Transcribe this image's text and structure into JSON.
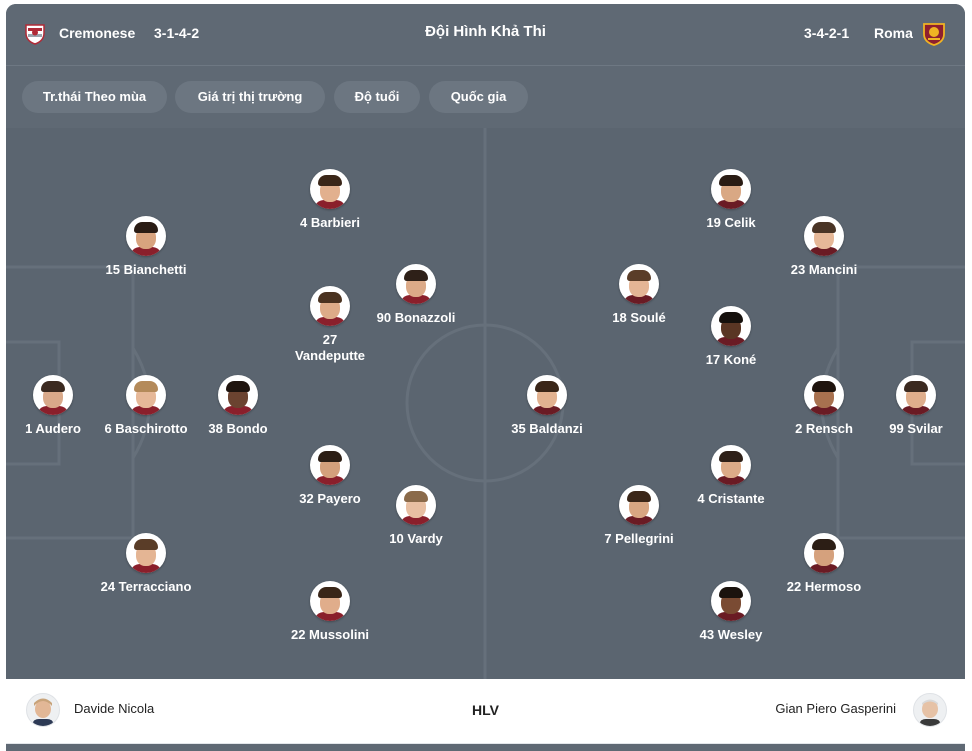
{
  "header": {
    "home_team": "Cremonese",
    "home_formation": "3-1-4-2",
    "title": "Đội Hình Khả Thi",
    "away_formation": "3-4-2-1",
    "away_team": "Roma",
    "home_logo_icon": "cremonese-crest-icon",
    "away_logo_icon": "roma-crest-icon"
  },
  "filters": [
    "Tr.thái Theo mùa",
    "Giá trị thị trường",
    "Độ tuổi",
    "Quốc gia"
  ],
  "home_players": [
    {
      "label": "1 Audero",
      "skin": "#d9a98a",
      "hair": "#3b2a20",
      "shirt": "#8a1f2b"
    },
    {
      "label": "6 Baschirotto",
      "skin": "#e6b898",
      "hair": "#b48a5a",
      "shirt": "#8a1f2b"
    },
    {
      "label": "38 Bondo",
      "skin": "#6b4330",
      "hair": "#1f140e",
      "shirt": "#8a1f2b"
    },
    {
      "label": "15 Bianchetti",
      "skin": "#d8a37e",
      "hair": "#2a1c14",
      "shirt": "#8a1f2b"
    },
    {
      "label": "24 Terracciano",
      "skin": "#e4b594",
      "hair": "#5a3d28",
      "shirt": "#8a1f2b"
    },
    {
      "label": "4 Barbieri",
      "skin": "#e2b08e",
      "hair": "#3a2618",
      "shirt": "#8a1f2b"
    },
    {
      "label": "27 Vandeputte",
      "skin": "#ddab88",
      "hair": "#4a3220",
      "shirt": "#8a1f2b"
    },
    {
      "label": "32 Payero",
      "skin": "#d4a07c",
      "hair": "#2c1e15",
      "shirt": "#8a1f2b"
    },
    {
      "label": "22 Mussolini",
      "skin": "#e0ad8b",
      "hair": "#3a2618",
      "shirt": "#8a1f2b"
    },
    {
      "label": "90 Bonazzoli",
      "skin": "#dcaa88",
      "hair": "#2e2018",
      "shirt": "#8a1f2b"
    },
    {
      "label": "10 Vardy",
      "skin": "#e8bfa2",
      "hair": "#8a6a4a",
      "shirt": "#8a1f2b"
    }
  ],
  "away_players": [
    {
      "label": "99 Svilar",
      "skin": "#dfae8c",
      "hair": "#3b2a20",
      "shirt": "#6a1b24"
    },
    {
      "label": "23 Mancini",
      "skin": "#e6b898",
      "hair": "#4a3526",
      "shirt": "#6a1b24"
    },
    {
      "label": "2 Rensch",
      "skin": "#a8714f",
      "hair": "#1f140e",
      "shirt": "#6a1b24"
    },
    {
      "label": "22 Hermoso",
      "skin": "#d5a17d",
      "hair": "#2c1e15",
      "shirt": "#6a1b24"
    },
    {
      "label": "19 Celik",
      "skin": "#d9a884",
      "hair": "#2a1c14",
      "shirt": "#6a1b24"
    },
    {
      "label": "17 Koné",
      "skin": "#5a3624",
      "hair": "#15100c",
      "shirt": "#6a1b24"
    },
    {
      "label": "4 Cristante",
      "skin": "#dcab88",
      "hair": "#2e2018",
      "shirt": "#6a1b24"
    },
    {
      "label": "43 Wesley",
      "skin": "#7a4b33",
      "hair": "#1b130e",
      "shirt": "#6a1b24"
    },
    {
      "label": "18 Soulé",
      "skin": "#e4b595",
      "hair": "#5a3d28",
      "shirt": "#6a1b24"
    },
    {
      "label": "7 Pellegrini",
      "skin": "#d8a682",
      "hair": "#3a2618",
      "shirt": "#6a1b24"
    },
    {
      "label": "35 Baldanzi",
      "skin": "#e2b290",
      "hair": "#3a2618",
      "shirt": "#6a1b24"
    }
  ],
  "coaches": {
    "home": "Davide Nicola",
    "label": "HLV",
    "away": "Gian Piero Gasperini"
  }
}
